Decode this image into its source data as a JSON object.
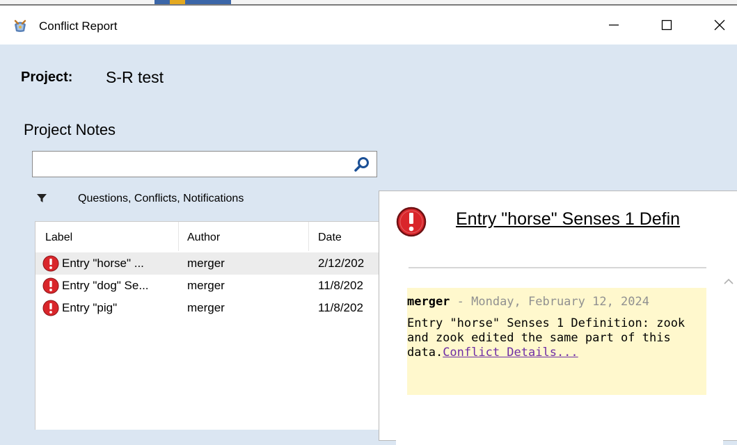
{
  "window": {
    "title": "Conflict Report",
    "controls": {
      "minimize": "—",
      "maximize": "☐",
      "close": "✕"
    }
  },
  "project": {
    "label": "Project:",
    "name": "S-R test"
  },
  "notes": {
    "heading": "Project Notes",
    "search": {
      "value": "",
      "placeholder": ""
    },
    "filter_label": "Questions, Conflicts, Notifications",
    "columns": [
      "Label",
      "Author",
      "Date"
    ],
    "rows": [
      {
        "label": "Entry \"horse\" ...",
        "author": "merger",
        "date": "2/12/202",
        "selected": true
      },
      {
        "label": "Entry \"dog\" Se...",
        "author": "merger",
        "date": "11/8/202",
        "selected": false
      },
      {
        "label": "Entry \"pig\"",
        "author": "merger",
        "date": "11/8/202",
        "selected": false
      }
    ]
  },
  "detail": {
    "title": "Entry \"horse\" Senses 1 Defin",
    "message": {
      "author": "merger",
      "date": " - Monday, February 12, 2024",
      "body": "Entry \"horse\" Senses 1 Definition: zook and zook edited the same part of this data.",
      "link": "Conflict Details..."
    }
  },
  "colors": {
    "background": "#dbe6f2",
    "conflict_red": "#d9262b",
    "message_bg": "#fff8cd",
    "link": "#6e2ea5"
  },
  "icons": {
    "app": "app-icon",
    "search": "search-icon",
    "filter": "filter-icon",
    "conflict": "conflict-icon",
    "scroll_up": "chevron-up-icon"
  }
}
